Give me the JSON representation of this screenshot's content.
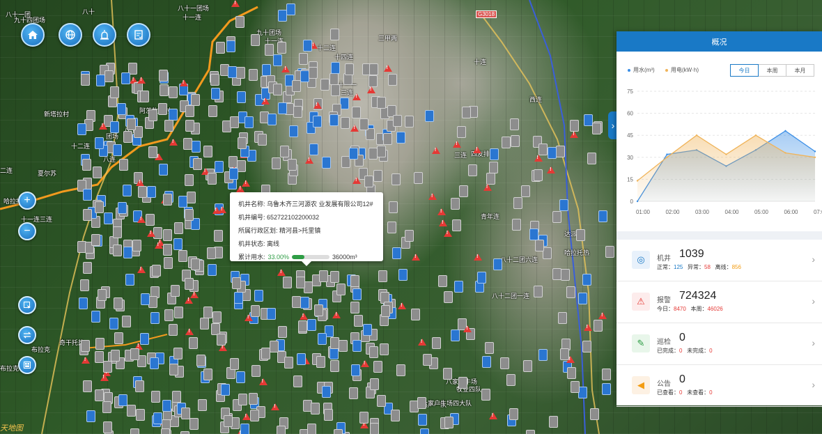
{
  "map": {
    "labels": [
      {
        "text": "八十",
        "x": 118,
        "y": 10
      },
      {
        "text": "八十一团场",
        "x": 255,
        "y": 5
      },
      {
        "text": "十一连",
        "x": 262,
        "y": 18
      },
      {
        "text": "九十四团场",
        "x": 20,
        "y": 22
      },
      {
        "text": "八十一团",
        "x": 8,
        "y": 14
      },
      {
        "text": "九十团场",
        "x": 368,
        "y": 40
      },
      {
        "text": "十一连",
        "x": 380,
        "y": 52
      },
      {
        "text": "三甲两",
        "x": 543,
        "y": 48
      },
      {
        "text": "十二连",
        "x": 455,
        "y": 62
      },
      {
        "text": "十四连",
        "x": 480,
        "y": 75
      },
      {
        "text": "十连",
        "x": 680,
        "y": 82
      },
      {
        "text": "十一一",
        "x": 485,
        "y": 115
      },
      {
        "text": "十三连",
        "x": 480,
        "y": 126
      },
      {
        "text": "新塔拉村",
        "x": 63,
        "y": 157
      },
      {
        "text": "阿茨牧场村",
        "x": 200,
        "y": 152
      },
      {
        "text": "八十二",
        "x": 178,
        "y": 180
      },
      {
        "text": "团场",
        "x": 152,
        "y": 189
      },
      {
        "text": "十二连",
        "x": 102,
        "y": 203
      },
      {
        "text": "八连",
        "x": 148,
        "y": 222
      },
      {
        "text": "夏尔苏",
        "x": 54,
        "y": 242
      },
      {
        "text": "二连",
        "x": 0,
        "y": 238
      },
      {
        "text": "西连",
        "x": 760,
        "y": 136
      },
      {
        "text": "四友排",
        "x": 676,
        "y": 214
      },
      {
        "text": "三连",
        "x": 652,
        "y": 216
      },
      {
        "text": "青年连",
        "x": 690,
        "y": 304
      },
      {
        "text": "达派村",
        "x": 810,
        "y": 329
      },
      {
        "text": "哈拉托热",
        "x": 810,
        "y": 356
      },
      {
        "text": "八十二团六连",
        "x": 718,
        "y": 366
      },
      {
        "text": "八十二团一连",
        "x": 706,
        "y": 418
      },
      {
        "text": "奇干托热",
        "x": 85,
        "y": 485
      },
      {
        "text": "布拉克",
        "x": 45,
        "y": 495
      },
      {
        "text": "哈拉托热",
        "x": 5,
        "y": 282
      },
      {
        "text": "十一连三连",
        "x": 30,
        "y": 308
      },
      {
        "text": "八家户牛场",
        "x": 640,
        "y": 541
      },
      {
        "text": "牧业四队",
        "x": 655,
        "y": 552
      },
      {
        "text": "八家户一队",
        "x": 596,
        "y": 574
      },
      {
        "text": "八家户牛场四大队",
        "x": 605,
        "y": 572
      },
      {
        "text": "布拉克",
        "x": 0,
        "y": 522
      }
    ],
    "road_badge": "G3018"
  },
  "toolbar": {
    "buttons": [
      {
        "name": "home-button",
        "icon": "home-icon"
      },
      {
        "name": "globe-button",
        "icon": "globe-icon"
      },
      {
        "name": "alarm-button",
        "icon": "alarm-icon"
      },
      {
        "name": "report-button",
        "icon": "report-icon"
      }
    ]
  },
  "zoom": {
    "in": "+",
    "out": "−"
  },
  "popup": {
    "name_label": "机井名称:",
    "name_value": "乌鲁木齐三河源农 业发展有限公司12#",
    "id_label": "机井编号:",
    "id_value": "652722102200032",
    "region_label": "所属行政区划:",
    "region_value": "精河县>托里镇",
    "status_label": "机井状态:",
    "status_value": "离线",
    "usage_label": "累计用水:",
    "usage_percent": "33.00%",
    "usage_fraction": 0.33,
    "usage_total": "36000m³"
  },
  "panel": {
    "title": "概况",
    "legend_water": "用水(m³)",
    "legend_power": "用电(kW·h)",
    "tabs": [
      "今日",
      "本周",
      "本月"
    ],
    "active_tab": 0,
    "stats": [
      {
        "name": "wells",
        "label": "机井",
        "value": "1039",
        "icon": "well-icon",
        "subs": [
          {
            "k": "正常：",
            "v": "125",
            "c": "c-blue"
          },
          {
            "k": "异常：",
            "v": "58",
            "c": "c-red"
          },
          {
            "k": "离线：",
            "v": "856",
            "c": "c-orange"
          }
        ]
      },
      {
        "name": "alarms",
        "label": "报警",
        "value": "724324",
        "icon": "alarm-icon",
        "subs": [
          {
            "k": "今日：",
            "v": "8470",
            "c": "c-red"
          },
          {
            "k": "本周：",
            "v": "46026",
            "c": "c-red"
          }
        ]
      },
      {
        "name": "patrol",
        "label": "巡检",
        "value": "0",
        "icon": "patrol-icon",
        "subs": [
          {
            "k": "已完成：",
            "v": "0",
            "c": "c-red"
          },
          {
            "k": "未完成：",
            "v": "0",
            "c": "c-red"
          }
        ]
      },
      {
        "name": "notices",
        "label": "公告",
        "value": "0",
        "icon": "notice-icon",
        "subs": [
          {
            "k": "已查看：",
            "v": "0",
            "c": "c-red"
          },
          {
            "k": "未查看：",
            "v": "0",
            "c": "c-red"
          }
        ]
      }
    ]
  },
  "chart_data": {
    "type": "area",
    "x": [
      "01:00",
      "02:00",
      "03:00",
      "04:00",
      "05:00",
      "06:00",
      "07:00"
    ],
    "yticks": [
      0,
      15,
      30,
      45,
      60,
      75
    ],
    "ylim": [
      0,
      75
    ],
    "series": [
      {
        "name": "用水(m³)",
        "color": "#3a8ee6",
        "values": [
          0,
          32,
          35,
          24,
          35,
          48,
          34
        ]
      },
      {
        "name": "用电(kW·h)",
        "color": "#f0b45a",
        "values": [
          14,
          30,
          45,
          32,
          45,
          33,
          30
        ]
      }
    ]
  },
  "watermark": "天地图",
  "colors": {
    "accent": "#1979c6",
    "offline": "#8d8d8d",
    "normal": "#2a76d1",
    "alarm": "#e53935"
  }
}
